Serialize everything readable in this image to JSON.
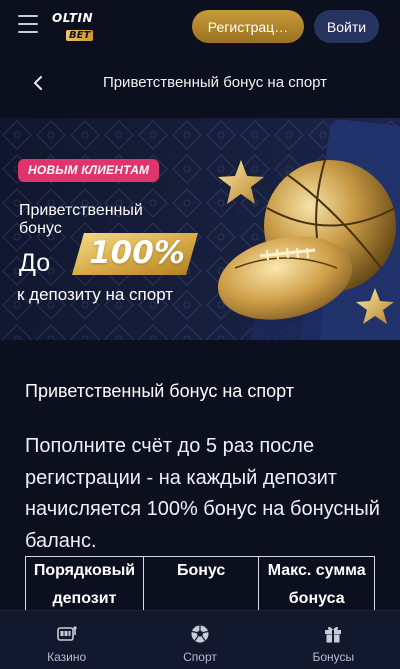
{
  "header": {
    "logo_top": "OLTIN",
    "logo_bottom": "BET",
    "register_label": "Регистрац…",
    "login_label": "Войти"
  },
  "subheader": {
    "title": "Приветственный бонус на спорт"
  },
  "banner": {
    "tag": "НОВЫМ КЛИЕНТАМ",
    "line1": "Приветственный",
    "line2": "бонус",
    "upto": "До",
    "percent": "100%",
    "line4": "к депозиту на спорт"
  },
  "content": {
    "heading": "Приветственный бонус на спорт",
    "paragraph": "Пополните счёт до 5 раз после регистрации - на каждый депозит начисляется 100% бонус на бонусный баланс.",
    "table": {
      "headers": [
        "Порядковый депозит",
        "Бонус",
        "Макс. сумма бонуса"
      ]
    }
  },
  "bottom_nav": {
    "items": [
      {
        "label": "Казино",
        "icon": "slot-machine-icon"
      },
      {
        "label": "Спорт",
        "icon": "soccer-ball-icon"
      },
      {
        "label": "Бонусы",
        "icon": "gift-icon"
      }
    ]
  },
  "colors": {
    "background": "#0b0f1e",
    "accent_gold": "#c79a3a",
    "login_button": "#26345f",
    "tag_pink": "#e0356a"
  }
}
